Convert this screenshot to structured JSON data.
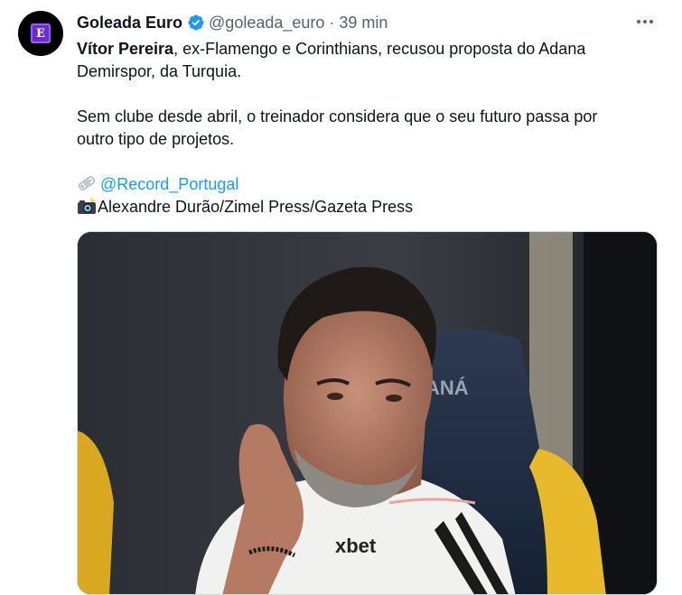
{
  "tweet": {
    "author": {
      "display_name": "Goleada Euro",
      "handle": "@goleada_euro",
      "avatar_letter": "E",
      "verified": true
    },
    "separator": "·",
    "time": "39 min",
    "text": {
      "line1_bold": "Vítor Pereira",
      "line1_rest": ", ex-Flamengo e Corinthians, recusou proposta do Adana",
      "line2": "Demirspor, da Turquia.",
      "line3": "Sem clube desde abril, o treinador considera que o seu futuro passa por",
      "line4": "outro tipo de projetos.",
      "source_link": "@Record_Portugal",
      "credit": "Alexandre Durão/Zimel Press/Gazeta Press"
    },
    "media": {
      "seat_text": "ANÁ",
      "shirt_text": "xbet"
    },
    "colors": {
      "link": "#1d9bf0",
      "secondary": "#536471",
      "verified": "#1d9bf0"
    }
  }
}
